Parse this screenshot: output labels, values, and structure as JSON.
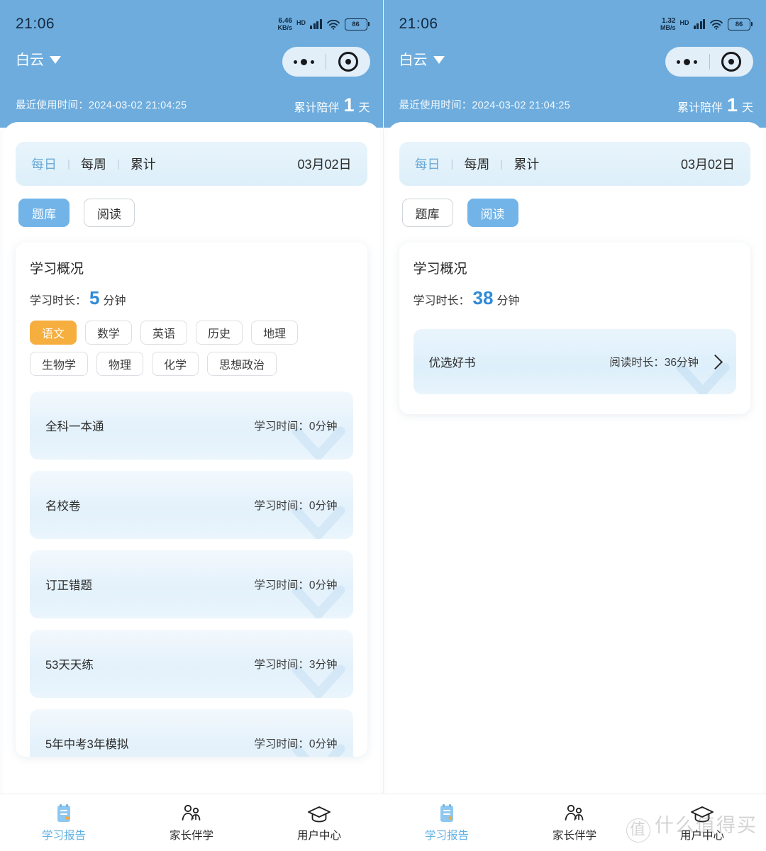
{
  "statusbar": {
    "time": "21:06",
    "netspeed_left": "6.46",
    "netspeed_left_unit": "KB/s",
    "netspeed_right": "1.32",
    "netspeed_right_unit": "MB/s",
    "hd_label": "HD",
    "battery": "86"
  },
  "header": {
    "nickname": "白云",
    "last_use_label": "最近使用时间：",
    "last_use_value": "2024-03-02 21:04:25",
    "companion_label": "累计陪伴",
    "companion_days": "1",
    "companion_unit": "天"
  },
  "segment": {
    "daily": "每日",
    "weekly": "每周",
    "total": "累计",
    "divider": "|",
    "date": "03月02日"
  },
  "mode_pills": {
    "question_bank": "题库",
    "reading": "阅读"
  },
  "left_panel": {
    "card_title": "学习概况",
    "duration_label": "学习时长：",
    "duration_value": "5",
    "duration_unit": "分钟",
    "subjects": [
      {
        "label": "语文",
        "active": true
      },
      {
        "label": "数学",
        "active": false
      },
      {
        "label": "英语",
        "active": false
      },
      {
        "label": "历史",
        "active": false
      },
      {
        "label": "地理",
        "active": false
      },
      {
        "label": "生物学",
        "active": false
      },
      {
        "label": "物理",
        "active": false
      },
      {
        "label": "化学",
        "active": false
      },
      {
        "label": "思想政治",
        "active": false
      }
    ],
    "rows": [
      {
        "name": "全科一本通",
        "time": "学习时间：0分钟"
      },
      {
        "name": "名校卷",
        "time": "学习时间：0分钟"
      },
      {
        "name": "订正错题",
        "time": "学习时间：0分钟"
      },
      {
        "name": "53天天练",
        "time": "学习时间：3分钟"
      },
      {
        "name": "5年中考3年模拟",
        "time": "学习时间：0分钟"
      }
    ]
  },
  "right_panel": {
    "card_title": "学习概况",
    "duration_label": "学习时长：",
    "duration_value": "38",
    "duration_unit": "分钟",
    "read_row": {
      "name": "优选好书",
      "time": "阅读时长：36分钟"
    }
  },
  "tabbar": {
    "items": [
      {
        "label": "学习报告",
        "icon": "report-clipboard-icon",
        "active": true
      },
      {
        "label": "家长伴学",
        "icon": "parent-child-icon",
        "active": false
      },
      {
        "label": "用户中心",
        "icon": "graduation-cap-icon",
        "active": false
      }
    ]
  },
  "watermark": {
    "mark": "值",
    "text": "什么值得买"
  },
  "colors": {
    "header_blue": "#6DACDD",
    "accent_blue": "#72B4E8",
    "duration_blue": "#2F8AD6",
    "subject_orange": "#F6AE3E",
    "row_blue": "#E3F1FB"
  }
}
